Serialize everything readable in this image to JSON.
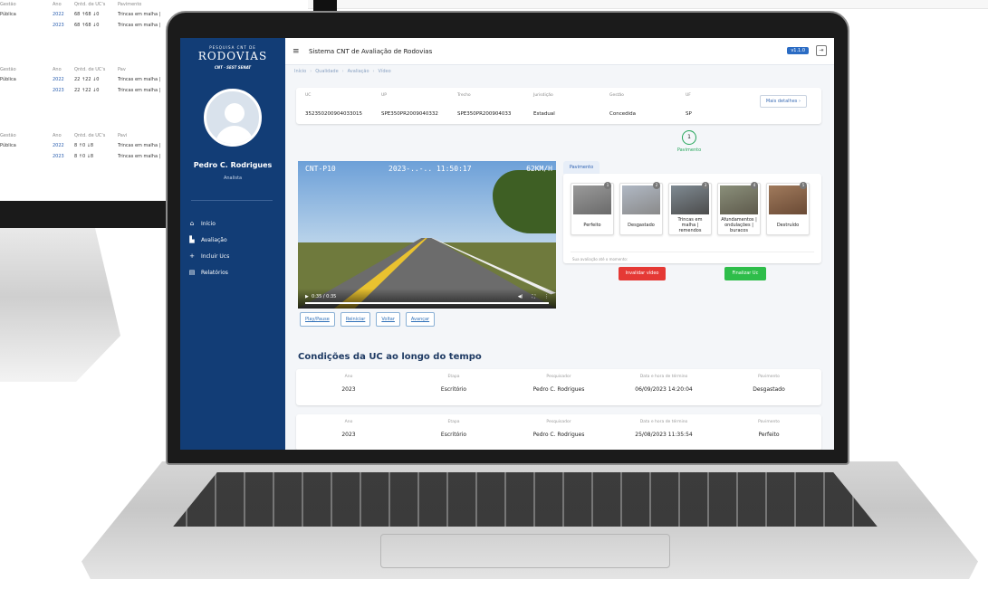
{
  "background_table": {
    "blocks": [
      {
        "headers": {
          "gestao": "Gestão",
          "ano": "Ano",
          "qtd": "Qntd. de UC's",
          "pav": "Pavimento"
        },
        "rows": [
          {
            "gestao": "Pública",
            "ano": "2022",
            "qtd": "68 ↑68 ↓0",
            "pav": "Trincas em malha |"
          },
          {
            "gestao": "",
            "ano": "2023",
            "qtd": "68 ↑68 ↓0",
            "pav": "Trincas em malha |"
          }
        ]
      },
      {
        "headers": {
          "gestao": "Gestão",
          "ano": "Ano",
          "qtd": "Qntd. de UC's",
          "pav": "Pav"
        },
        "rows": [
          {
            "gestao": "Pública",
            "ano": "2022",
            "qtd": "22 ↑22 ↓0",
            "pav": "Trincas em malha |"
          },
          {
            "gestao": "",
            "ano": "2023",
            "qtd": "22 ↑22 ↓0",
            "pav": "Trincas em malha |"
          }
        ]
      },
      {
        "headers": {
          "gestao": "Gestão",
          "ano": "Ano",
          "qtd": "Qntd. de UC's",
          "pav": "Pavi"
        },
        "rows": [
          {
            "gestao": "Pública",
            "ano": "2022",
            "qtd": "8 ↑0 ↓8",
            "pav": "Trincas em malha |"
          },
          {
            "gestao": "",
            "ano": "2023",
            "qtd": "8 ↑0 ↓8",
            "pav": "Trincas em malha |"
          }
        ]
      }
    ]
  },
  "sidebar": {
    "brand_top": "PESQUISA CNT DE",
    "brand": "RODOVIAS",
    "brand_sub": "CNT · SEST SENAT",
    "user_name": "Pedro C. Rodrigues",
    "user_role": "Analista",
    "items": [
      {
        "label": "Início",
        "icon": "home-icon"
      },
      {
        "label": "Avaliação",
        "icon": "road-icon"
      },
      {
        "label": "Incluir Ucs",
        "icon": "plus-icon"
      },
      {
        "label": "Relatórios",
        "icon": "report-icon"
      }
    ]
  },
  "header": {
    "title": "Sistema CNT de Avaliação de Rodovias",
    "version": "v1.1.0"
  },
  "breadcrumb": [
    "Início",
    "Qualidade",
    "Avaliação",
    "Vídeo"
  ],
  "info": {
    "labels": [
      "UC",
      "UP",
      "Trecho",
      "Jurisdição",
      "Gestão",
      "UF"
    ],
    "values": [
      "35235020090403301​5",
      "SPE350PR2009040332",
      "SPE350PR200904033",
      "Estadual",
      "Concedida",
      "SP"
    ],
    "more_button": "Mais detalhes  ›"
  },
  "step": {
    "number": "1",
    "label": "Pavimento"
  },
  "video": {
    "overlay_left": "CNT-P10",
    "overlay_mid": "2023-..-.. 11:50:17",
    "overlay_right": "62KM/H",
    "time": "0:35 / 0:35",
    "buttons": [
      "Play/Pause",
      "Reiniciar",
      "Voltar",
      "Avançar"
    ]
  },
  "pavimento": {
    "tab": "Pavimento",
    "options": [
      {
        "num": "1",
        "label": "Perfeito"
      },
      {
        "num": "2",
        "label": "Desgastado"
      },
      {
        "num": "3",
        "label": "Trincas em malha | remendos"
      },
      {
        "num": "4",
        "label": "Afundamentos | ondulações | buracos"
      },
      {
        "num": "5",
        "label": "Destruído"
      }
    ],
    "note": "Sua avaliação até o momento:",
    "invalidate": "Invalidar vídeo",
    "finalize": "Finalizar Uc"
  },
  "history": {
    "title": "Condições da UC ao longo do tempo",
    "labels": [
      "Ano",
      "Etapa",
      "Pesquisador",
      "Data e hora de término",
      "Pavimento"
    ],
    "rows": [
      {
        "ano": "2023",
        "etapa": "Escritório",
        "pesquisador": "Pedro C. Rodrigues",
        "data": "06/09/2023 14:20:04",
        "pavimento": "Desgastado"
      },
      {
        "ano": "2023",
        "etapa": "Escritório",
        "pesquisador": "Pedro C. Rodrigues",
        "data": "25/08/2023 11:35:54",
        "pavimento": "Perfeito"
      }
    ]
  },
  "colors": {
    "sidebar": "#123d76",
    "accent": "#2b6cc4",
    "danger": "#e53935",
    "success": "#2ebd4a"
  }
}
